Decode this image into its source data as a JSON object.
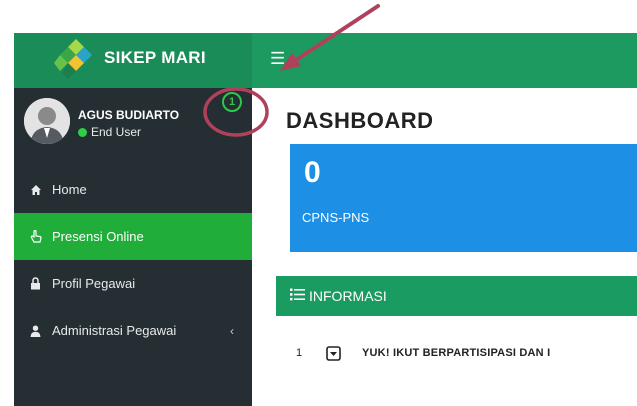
{
  "app": {
    "name": "SIKEP MARI"
  },
  "user": {
    "name": "AGUS BUDIARTO",
    "role": "End User",
    "notification_count": "1"
  },
  "sidebar": {
    "items": [
      {
        "label": "Home",
        "icon": "home-icon"
      },
      {
        "label": "Presensi Online",
        "icon": "hand-pointer-icon",
        "active": true
      },
      {
        "label": "Profil Pegawai",
        "icon": "lock-icon"
      },
      {
        "label": "Administrasi Pegawai",
        "icon": "user-icon",
        "has_submenu": true
      }
    ],
    "submenu_indicator": "‹"
  },
  "main": {
    "title": "DASHBOARD",
    "stat": {
      "value": "0",
      "label": "CPNS-PNS"
    },
    "info": {
      "header": "INFORMASI",
      "rows": [
        {
          "no": "1",
          "text": "YUK! IKUT BERPARTISIPASI DAN I"
        }
      ]
    }
  },
  "colors": {
    "header_green": "#1c9a60",
    "sidebar_dark": "#242e33",
    "active_green": "#21ad3a",
    "stat_blue": "#1d8fe4",
    "annotation_red": "#b0415b"
  }
}
